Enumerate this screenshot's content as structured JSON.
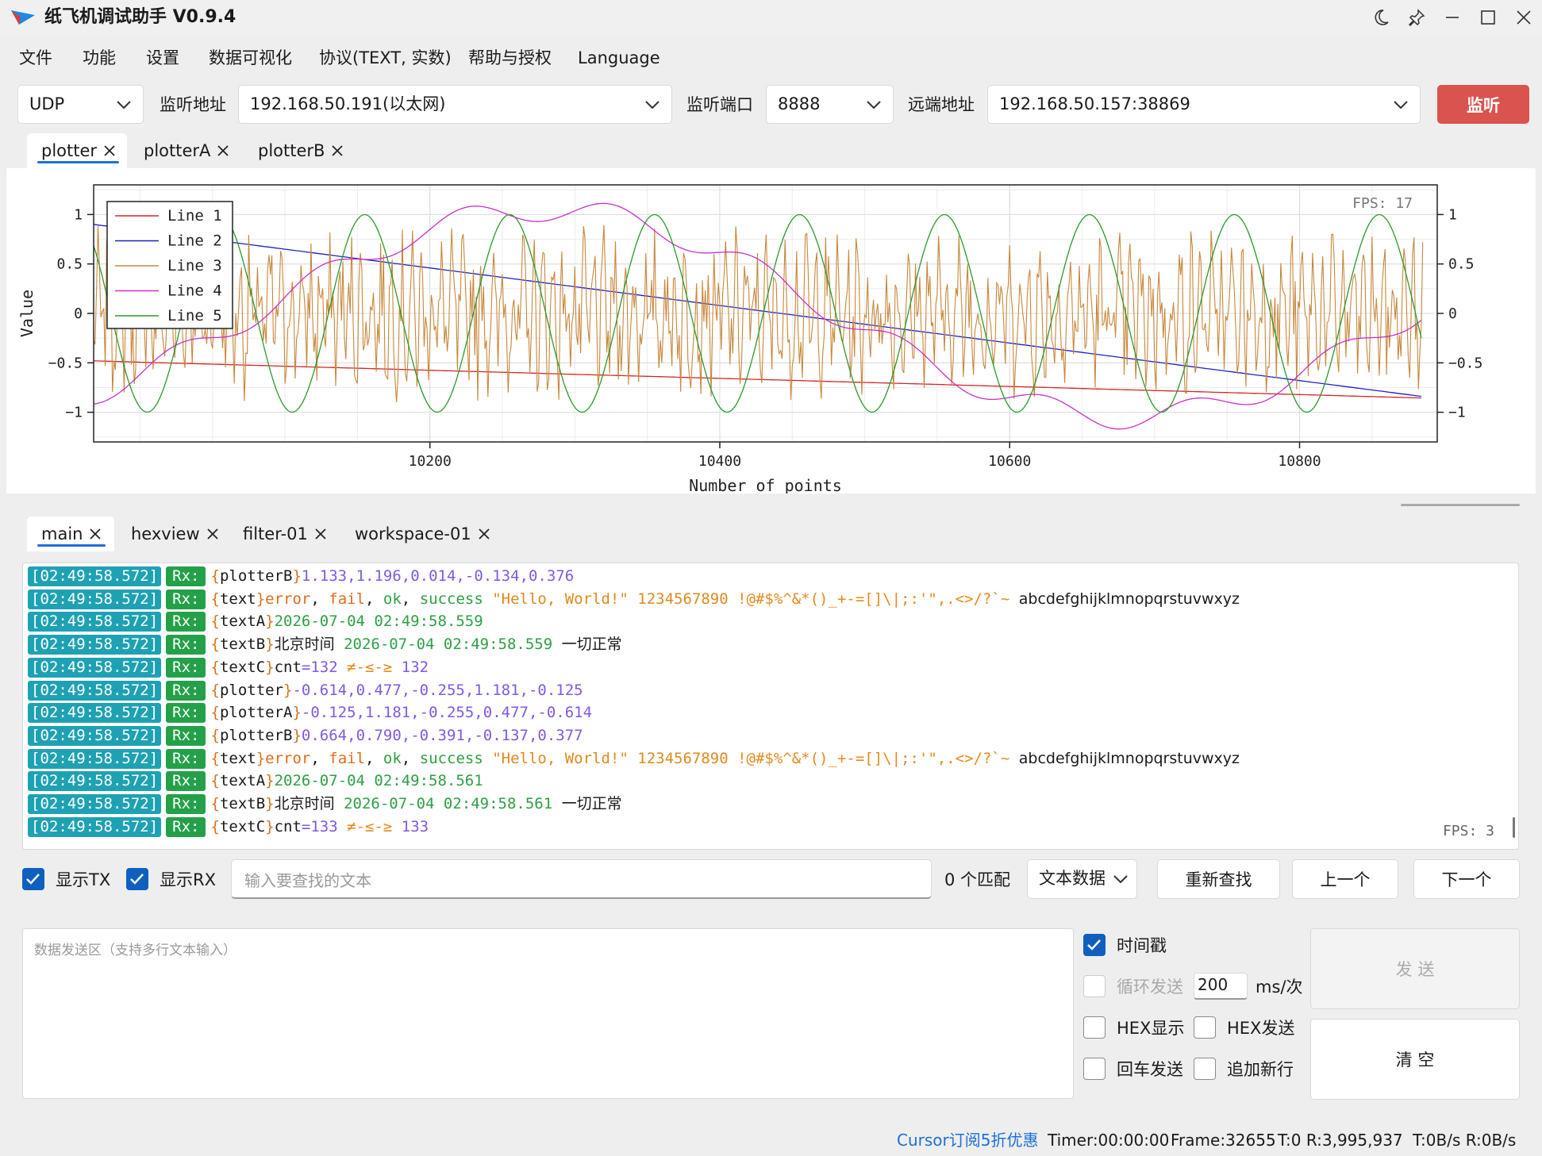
{
  "titlebar": {
    "title": "纸飞机调试助手 V0.9.4"
  },
  "menu": [
    "文件",
    "功能",
    "设置",
    "数据可视化",
    "协议(TEXT, 实数)",
    "帮助与授权",
    "Language"
  ],
  "connection": {
    "protocol": "UDP",
    "listen_addr_label": "监听地址",
    "listen_addr": "192.168.50.191(以太网)",
    "listen_port_label": "监听端口",
    "listen_port": "8888",
    "remote_addr_label": "远端地址",
    "remote_addr": "192.168.50.157:38869",
    "listen_button": "监听"
  },
  "plot_tabs": [
    "plotter",
    "plotterA",
    "plotterB"
  ],
  "chart_data": {
    "type": "line",
    "fps": "FPS: 17",
    "xlabel": "Number of points",
    "ylabel": "Value",
    "xlim": [
      9968,
      10895
    ],
    "ylim": [
      -1.3,
      1.3
    ],
    "x_ticks": [
      10200,
      10400,
      10600,
      10800
    ],
    "y_ticks": [
      1,
      0.5,
      0,
      -0.5,
      -1
    ],
    "y_tick_labels": [
      "1",
      "0.5",
      "0",
      "−0.5",
      "−1"
    ],
    "grid": true,
    "legend_position": "top-left",
    "series": [
      {
        "name": "Line 1",
        "color": "#d62728",
        "desc": "linear from -0.48 to -0.86"
      },
      {
        "name": "Line 2",
        "color": "#2020c8",
        "desc": "declining from 0.9 to -0.86"
      },
      {
        "name": "Line 3",
        "color": "#c8873a",
        "desc": "noise around 0 amplitude ~0.5"
      },
      {
        "name": "Line 4",
        "color": "#c832c8",
        "desc": "modulated wave between -1.2 and 1.2"
      },
      {
        "name": "Line 5",
        "color": "#2a9a2a",
        "desc": "sine amplitude 1 period ~100 points"
      }
    ]
  },
  "log_tabs": [
    "main",
    "hexview",
    "filter-01",
    "workspace-01"
  ],
  "log": {
    "fps": "FPS: 3",
    "timestamp": "[02:49:58.572]",
    "rx": "Rx:",
    "lines": [
      {
        "kind": "nums",
        "tag": "plotterB",
        "values": [
          "1.133",
          "1.196",
          "0.014",
          "-0.134",
          "0.376"
        ]
      },
      {
        "kind": "text",
        "tag": "text",
        "words": [
          "error",
          "fail",
          "ok",
          "success"
        ],
        "str": "\"Hello, World!\"",
        "nums": "1234567890",
        "symbols": "!@#$%^&*()_+-=[]\\|;:'\",.<>/?`~",
        "alpha": "abcdefghijklmnopqrstuvwxyz"
      },
      {
        "kind": "textA",
        "tag": "textA",
        "value": "2026-07-04 02:49:58.559"
      },
      {
        "kind": "textB",
        "tag": "textB",
        "prefix": "北京时间",
        "value": "2026-07-04 02:49:58.559",
        "suffix": "一切正常"
      },
      {
        "kind": "textC",
        "tag": "textC",
        "key": "cnt",
        "value": "=132",
        "symbols": "≠-≤-≥",
        "count": "132"
      },
      {
        "kind": "nums",
        "tag": "plotter",
        "values": [
          "-0.614",
          "0.477",
          "-0.255",
          "1.181",
          "-0.125"
        ]
      },
      {
        "kind": "nums",
        "tag": "plotterA",
        "values": [
          "-0.125",
          "1.181",
          "-0.255",
          "0.477",
          "-0.614"
        ]
      },
      {
        "kind": "nums",
        "tag": "plotterB",
        "values": [
          "0.664",
          "0.790",
          "-0.391",
          "-0.137",
          "0.377"
        ]
      },
      {
        "kind": "text",
        "tag": "text",
        "words": [
          "error",
          "fail",
          "ok",
          "success"
        ],
        "str": "\"Hello, World!\"",
        "nums": "1234567890",
        "symbols": "!@#$%^&*()_+-=[]\\|;:'\",.<>/?`~",
        "alpha": "abcdefghijklmnopqrstuvwxyz"
      },
      {
        "kind": "textA",
        "tag": "textA",
        "value": "2026-07-04 02:49:58.561"
      },
      {
        "kind": "textB",
        "tag": "textB",
        "prefix": "北京时间",
        "value": "2026-07-04 02:49:58.561",
        "suffix": "一切正常"
      },
      {
        "kind": "textC",
        "tag": "textC",
        "key": "cnt",
        "value": "=133",
        "symbols": "≠-≤-≥",
        "count": "133"
      }
    ]
  },
  "search": {
    "show_tx": "显示TX",
    "show_rx": "显示RX",
    "placeholder": "输入要查找的文本",
    "match": "0 个匹配",
    "mode": "文本数据",
    "research": "重新查找",
    "prev": "上一个",
    "next": "下一个"
  },
  "send": {
    "placeholder": "数据发送区（支持多行文本输入）",
    "timestamp": "时间戳",
    "loop_send": "循环发送",
    "interval": "200",
    "interval_unit": "ms/次",
    "hex_display": "HEX显示",
    "hex_send": "HEX发送",
    "enter_send": "回车发送",
    "append_newline": "追加新行",
    "send_button": "发 送",
    "clear_button": "清 空"
  },
  "status": {
    "promo": "Cursor订阅5折优惠",
    "timer": "Timer:00:00:00",
    "frame": "Frame:32655",
    "counts": "T:0 R:3,995,937",
    "rate": "T:0B/s R:0B/s"
  }
}
